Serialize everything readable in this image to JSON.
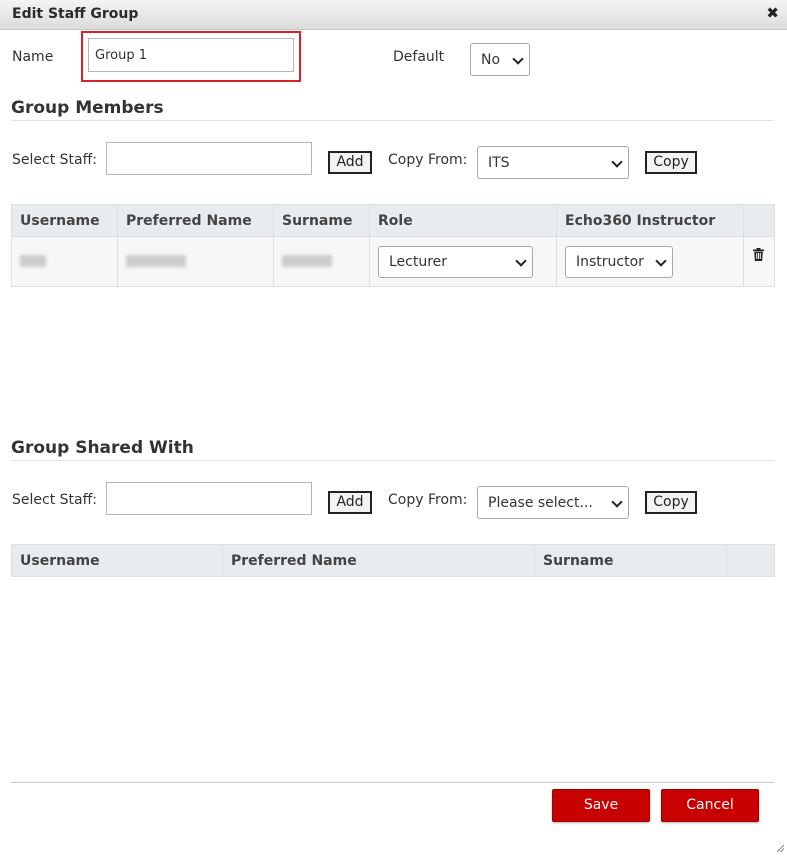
{
  "dialog": {
    "title": "Edit Staff Group",
    "close_icon": "✖"
  },
  "form": {
    "name_label": "Name",
    "name_value": "Group 1",
    "default_label": "Default",
    "default_value": "No"
  },
  "members": {
    "heading": "Group Members",
    "select_staff_label": "Select Staff:",
    "select_staff_value": "",
    "add_label": "Add",
    "copy_from_label": "Copy From:",
    "copy_from_value": "ITS",
    "copy_label": "Copy",
    "columns": [
      "Username",
      "Preferred Name",
      "Surname",
      "Role",
      "Echo360 Instructor"
    ],
    "rows": [
      {
        "role": "Lecturer",
        "echo360_instructor": "Instructor"
      }
    ]
  },
  "shared": {
    "heading": "Group Shared With",
    "select_staff_label": "Select Staff:",
    "select_staff_value": "",
    "add_label": "Add",
    "copy_from_label": "Copy From:",
    "copy_from_value": "Please select...",
    "copy_label": "Copy",
    "columns": [
      "Username",
      "Preferred Name",
      "Surname"
    ]
  },
  "footer": {
    "save_label": "Save",
    "cancel_label": "Cancel"
  },
  "colors": {
    "primary_button": "#c80000",
    "highlight_border": "#d6232b",
    "header_bg": "#e9ecef"
  },
  "icons": {
    "close": "close-icon",
    "delete": "trash-icon",
    "dropdown": "chevron-down-icon",
    "resize": "resize-handle-icon"
  }
}
